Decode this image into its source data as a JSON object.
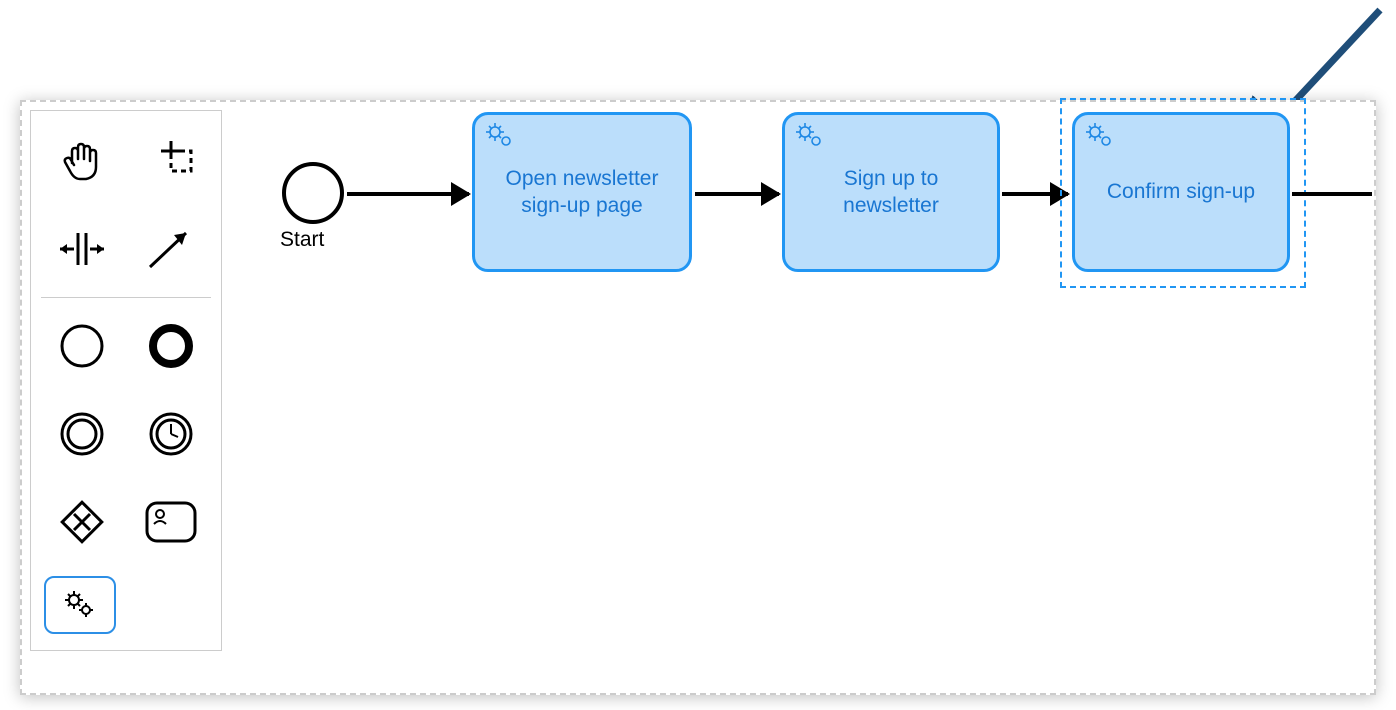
{
  "palette": {
    "tools": [
      {
        "name": "hand-tool",
        "icon": "hand"
      },
      {
        "name": "lasso-tool",
        "icon": "lasso"
      },
      {
        "name": "space-tool",
        "icon": "space"
      },
      {
        "name": "global-connect-tool",
        "icon": "connect"
      }
    ],
    "shapes": [
      {
        "name": "start-event-shape",
        "icon": "thin-circle"
      },
      {
        "name": "end-event-shape",
        "icon": "thick-circle"
      },
      {
        "name": "intermediate-event-shape",
        "icon": "double-circle"
      },
      {
        "name": "timer-event-shape",
        "icon": "timer-circle"
      },
      {
        "name": "exclusive-gateway-shape",
        "icon": "gateway"
      },
      {
        "name": "user-task-shape",
        "icon": "user-task"
      },
      {
        "name": "service-task-shape",
        "icon": "service-task",
        "selected": true
      }
    ]
  },
  "diagram": {
    "startEvent": {
      "label": "Start"
    },
    "tasks": [
      {
        "id": "task1",
        "label": "Open newsletter sign-up page",
        "type": "service",
        "selected": false
      },
      {
        "id": "task2",
        "label": "Sign up to newsletter",
        "type": "service",
        "selected": false
      },
      {
        "id": "task3",
        "label": "Confirm sign-up",
        "type": "service",
        "selected": true
      }
    ],
    "flows": [
      {
        "from": "start",
        "to": "task1"
      },
      {
        "from": "task1",
        "to": "task2"
      },
      {
        "from": "task2",
        "to": "task3"
      },
      {
        "from": "task3",
        "to": null
      }
    ]
  },
  "annotation": {
    "pointsTo": "task3"
  },
  "colors": {
    "taskFill": "#bbdefb",
    "taskStroke": "#2196f3",
    "taskText": "#1976d2",
    "annotationArrow": "#1f4e79"
  }
}
